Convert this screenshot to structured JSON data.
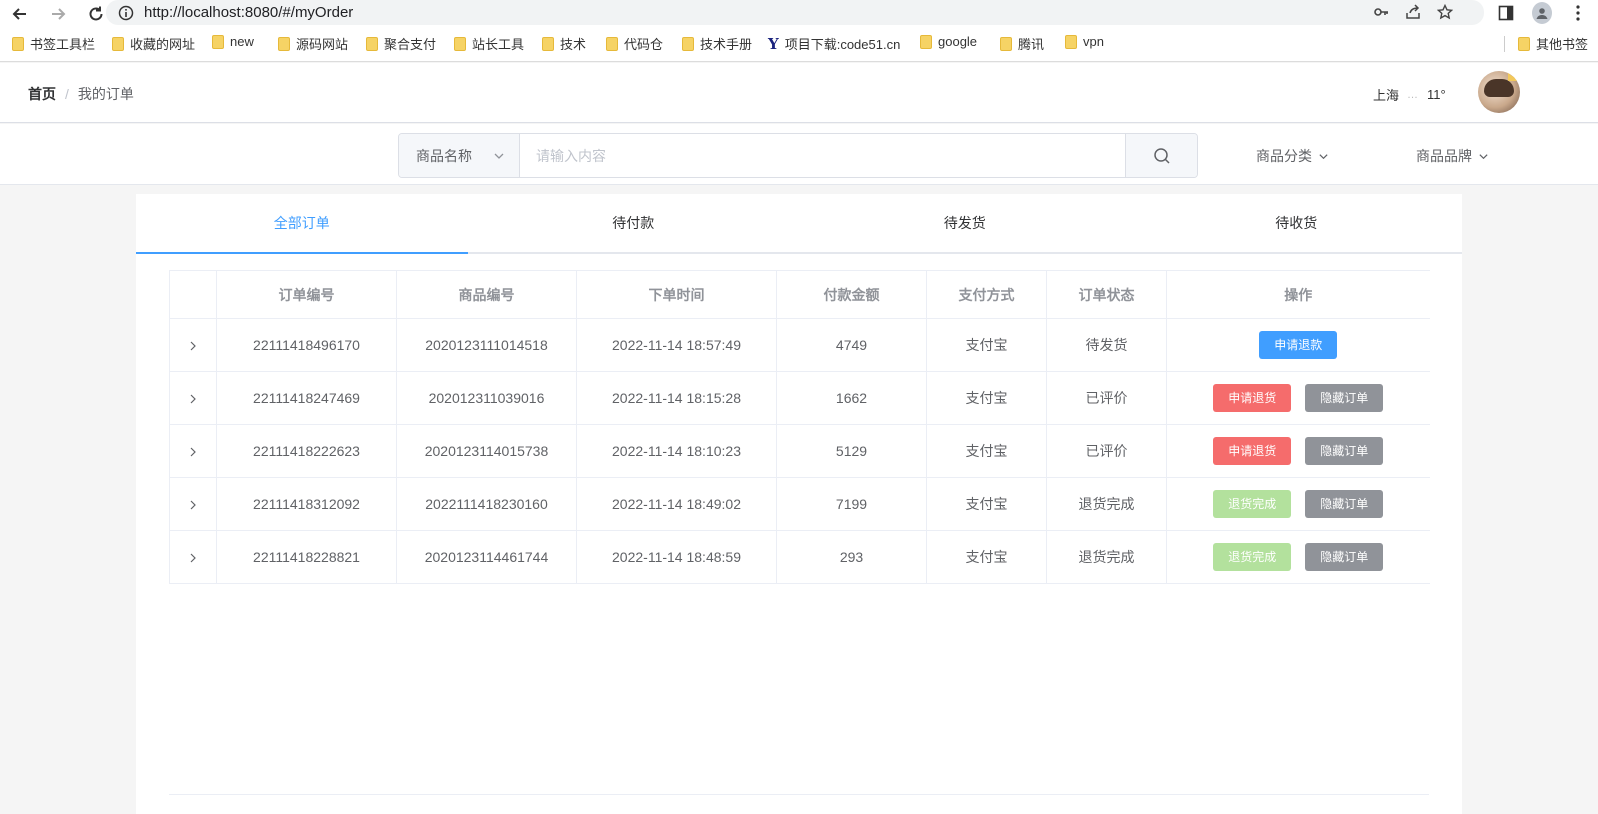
{
  "browser": {
    "url": "http://localhost:8080/#/myOrder",
    "bookmarks": [
      {
        "label": "书签工具栏",
        "icon": "folder-icon"
      },
      {
        "label": "收藏的网址",
        "icon": "folder-icon"
      },
      {
        "label": "new",
        "icon": "folder-icon"
      },
      {
        "label": "源码网站",
        "icon": "folder-icon"
      },
      {
        "label": "聚合支付",
        "icon": "folder-icon"
      },
      {
        "label": "站长工具",
        "icon": "folder-icon"
      },
      {
        "label": "技术",
        "icon": "folder-icon"
      },
      {
        "label": "代码仓",
        "icon": "folder-icon"
      },
      {
        "label": "技术手册",
        "icon": "folder-icon"
      },
      {
        "label": "项目下载:code51.cn",
        "icon": "site-logo-icon"
      },
      {
        "label": "google",
        "icon": "folder-icon"
      },
      {
        "label": "腾讯",
        "icon": "folder-icon"
      },
      {
        "label": "vpn",
        "icon": "folder-icon"
      },
      {
        "label": "其他书签",
        "icon": "folder-icon"
      }
    ]
  },
  "header": {
    "breadcrumb_home": "首页",
    "breadcrumb_sep": "/",
    "breadcrumb_current": "我的订单",
    "weather_city": "上海",
    "weather_temp": "11°"
  },
  "search": {
    "select_value": "商品名称",
    "placeholder": "请输入内容",
    "category_label": "商品分类",
    "brand_label": "商品品牌"
  },
  "tabs": [
    {
      "label": "全部订单",
      "active": true
    },
    {
      "label": "待付款",
      "active": false
    },
    {
      "label": "待发货",
      "active": false
    },
    {
      "label": "待收货",
      "active": false
    }
  ],
  "table": {
    "columns": [
      "",
      "订单编号",
      "商品编号",
      "下单时间",
      "付款金额",
      "支付方式",
      "订单状态",
      "操作"
    ],
    "rows": [
      {
        "order_no": "22111418496170",
        "product_no": "2020123111014518",
        "time": "2022-11-14 18:57:49",
        "amount": "4749",
        "payment": "支付宝",
        "status": "待发货",
        "actions": [
          {
            "label": "申请退款",
            "type": "primary"
          }
        ]
      },
      {
        "order_no": "22111418247469",
        "product_no": "202012311039016",
        "time": "2022-11-14 18:15:28",
        "amount": "1662",
        "payment": "支付宝",
        "status": "已评价",
        "actions": [
          {
            "label": "申请退货",
            "type": "danger"
          },
          {
            "label": "隐藏订单",
            "type": "info"
          }
        ]
      },
      {
        "order_no": "22111418222623",
        "product_no": "2020123114015738",
        "time": "2022-11-14 18:10:23",
        "amount": "5129",
        "payment": "支付宝",
        "status": "已评价",
        "actions": [
          {
            "label": "申请退货",
            "type": "danger"
          },
          {
            "label": "隐藏订单",
            "type": "info"
          }
        ]
      },
      {
        "order_no": "22111418312092",
        "product_no": "2022111418230160",
        "time": "2022-11-14 18:49:02",
        "amount": "7199",
        "payment": "支付宝",
        "status": "退货完成",
        "actions": [
          {
            "label": "退货完成",
            "type": "success-disabled"
          },
          {
            "label": "隐藏订单",
            "type": "info"
          }
        ]
      },
      {
        "order_no": "22111418228821",
        "product_no": "2020123114461744",
        "time": "2022-11-14 18:48:59",
        "amount": "293",
        "payment": "支付宝",
        "status": "退货完成",
        "actions": [
          {
            "label": "退货完成",
            "type": "success-disabled"
          },
          {
            "label": "隐藏订单",
            "type": "info"
          }
        ]
      }
    ]
  },
  "colors": {
    "primary": "#409eff",
    "danger": "#f56c6c",
    "success_light": "#b3e19d",
    "info": "#909399"
  }
}
